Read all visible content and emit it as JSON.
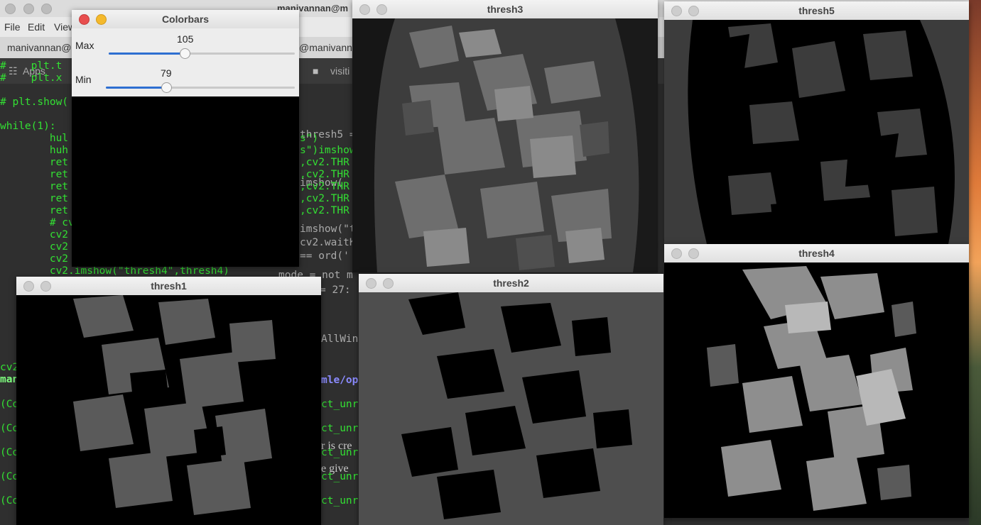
{
  "terminal": {
    "title": "manivannan@m",
    "menu": [
      "File",
      "Edit",
      "View"
    ],
    "tab_label_left": "manivannan@",
    "tab_label_right": "@manivanna",
    "bookmarks": {
      "apps": "Apps",
      "folder": "visiti"
    },
    "code_lines_left": [
      "#    plt.t",
      "#    plt.x",
      "",
      "# plt.show(",
      "",
      "while(1):",
      "        hul",
      "        huh",
      "        ret",
      "        ret",
      "        ret",
      "        ret",
      "        ret",
      "        # cv",
      "        cv2",
      "        cv2",
      "        cv2",
      "        cv2.imshow(\"thresh4\",thresh4)"
    ],
    "code_lines_mid": [
      "thresh5 =",
      "s\")",
      "s\")imshow(",
      ",cv2.THR",
      ",cv2.THR",
      "imshow(",
      ",cv2.THR",
      ",cv2.THR",
      ",cv2.THR",
      "imshow(\"t",
      "cv2.waitK",
      "== ord('",
      "mode = not m",
      "= 27:"
    ],
    "mid_lower_lines": {
      "allwin": "AllWin",
      "path": "mle/op",
      "unr": [
        "ct_unr",
        "ct_unr",
        "ct_unr",
        "ct_unr",
        "ct_unr"
      ],
      "serif1": "r is cre",
      "serif2": "e give"
    },
    "left_lower_lines": [
      "cv2",
      "man",
      "(Co",
      "(Co",
      "(Co",
      "(Co",
      "(Co"
    ]
  },
  "colorbars": {
    "title": "Colorbars",
    "max": {
      "label": "Max",
      "value": "105",
      "fraction": 0.41
    },
    "min": {
      "label": "Min",
      "value": "79",
      "fraction": 0.32
    }
  },
  "windows": {
    "thresh1": {
      "title": "thresh1"
    },
    "thresh2": {
      "title": "thresh2"
    },
    "thresh3": {
      "title": "thresh3"
    },
    "thresh4": {
      "title": "thresh4"
    },
    "thresh5": {
      "title": "thresh5"
    }
  },
  "colors": {
    "terminal_green": "#33e033",
    "slider_blue": "#2e6fd1",
    "close_red": "#e84e4e",
    "minimize_yellow": "#f4b92c"
  }
}
